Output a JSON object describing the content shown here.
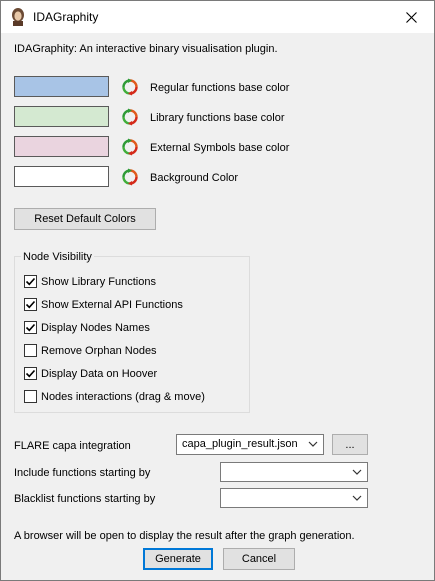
{
  "window": {
    "title": "IDAGraphity"
  },
  "description": "IDAGraphity: An interactive binary visualisation plugin.",
  "colors": [
    {
      "label": "Regular functions base color",
      "hex": "#a8c4e6"
    },
    {
      "label": "Library functions base color",
      "hex": "#d4e9d1"
    },
    {
      "label": "External Symbols base color",
      "hex": "#ead4df"
    },
    {
      "label": "Background Color",
      "hex": "#ffffff"
    }
  ],
  "reset_button": "Reset Default Colors",
  "node_visibility": {
    "title": "Node Visibility",
    "options": [
      {
        "label": "Show Library Functions",
        "checked": true
      },
      {
        "label": "Show External API Functions",
        "checked": true
      },
      {
        "label": "Display Nodes Names",
        "checked": true
      },
      {
        "label": "Remove Orphan Nodes",
        "checked": false
      },
      {
        "label": "Display Data on Hoover",
        "checked": true
      },
      {
        "label": "Nodes interactions (drag & move)",
        "checked": false
      }
    ]
  },
  "capa": {
    "label": "FLARE capa integration",
    "selected": "capa_plugin_result.json",
    "browse": "..."
  },
  "include": {
    "label": "Include functions starting by",
    "value": ""
  },
  "blacklist": {
    "label": "Blacklist functions starting by",
    "value": ""
  },
  "note": "A browser will be open to display the result after the graph generation.",
  "buttons": {
    "generate": "Generate",
    "cancel": "Cancel"
  }
}
